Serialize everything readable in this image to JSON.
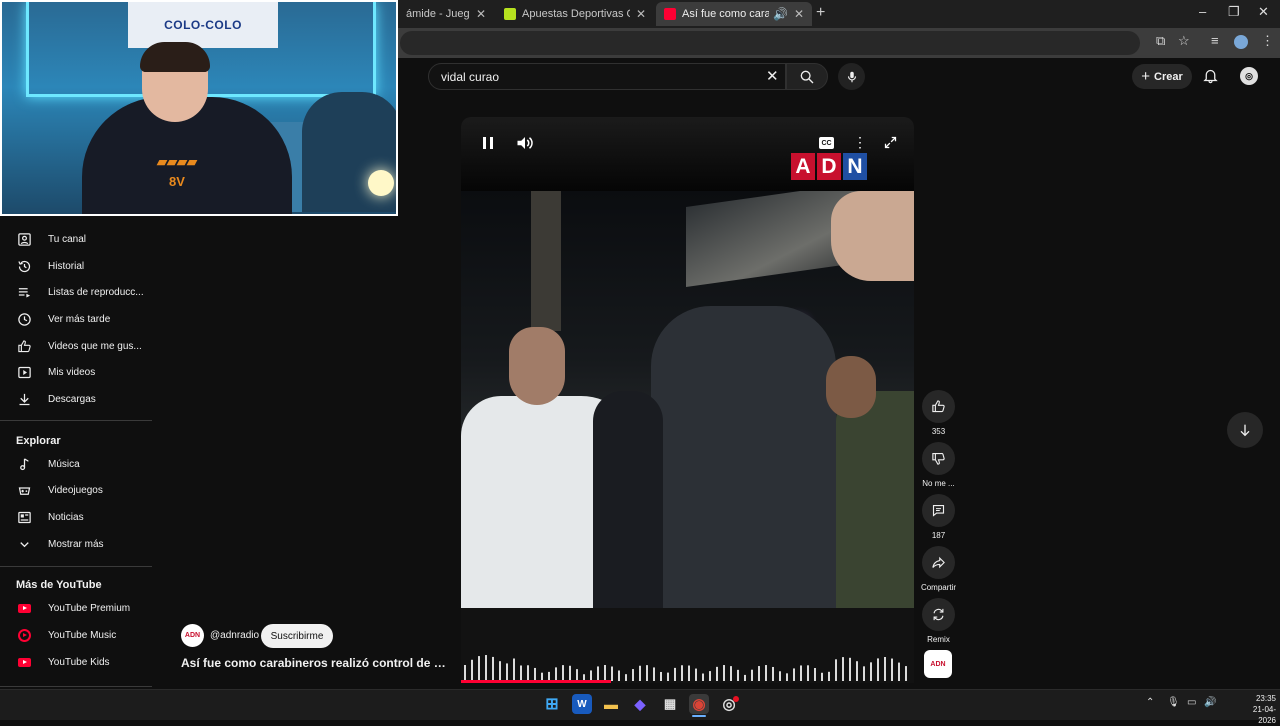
{
  "browser": {
    "tabs": [
      {
        "title": "ámide - Juega al ju",
        "active": false,
        "favicon_color": "#2a2a2a"
      },
      {
        "title": "Apuestas Deportivas Online en",
        "active": false,
        "favicon_color": "#b6e21f"
      },
      {
        "title": "Así fue como carabineros r",
        "active": true,
        "favicon_color": "#ff0033"
      }
    ],
    "new_tab": "+",
    "window_controls": {
      "minimize": "–",
      "restore": "❐",
      "close": "✕"
    }
  },
  "youtube": {
    "search": {
      "value": "vidal curao"
    },
    "create_label": "Crear"
  },
  "webcam": {
    "flag_text": "COLO-COLO",
    "hoodie_text": "8V"
  },
  "sidebar": {
    "you_items": [
      {
        "label": "Tu canal",
        "icon": "channel-icon"
      },
      {
        "label": "Historial",
        "icon": "history-icon"
      },
      {
        "label": "Listas de reproducc...",
        "icon": "playlist-icon"
      },
      {
        "label": "Ver más tarde",
        "icon": "watch-later-icon"
      },
      {
        "label": "Videos que me gus...",
        "icon": "like-icon"
      },
      {
        "label": "Mis videos",
        "icon": "my-videos-icon"
      },
      {
        "label": "Descargas",
        "icon": "download-icon"
      }
    ],
    "explore_heading": "Explorar",
    "explore_items": [
      {
        "label": "Música",
        "icon": "music-icon"
      },
      {
        "label": "Videojuegos",
        "icon": "gaming-icon"
      },
      {
        "label": "Noticias",
        "icon": "news-icon"
      },
      {
        "label": "Mostrar más",
        "icon": "chevron-down-icon"
      }
    ],
    "more_heading": "Más de YouTube",
    "more_items": [
      {
        "label": "YouTube Premium",
        "icon": "youtube-premium-icon"
      },
      {
        "label": "YouTube Music",
        "icon": "youtube-music-icon"
      },
      {
        "label": "YouTube Kids",
        "icon": "youtube-kids-icon"
      }
    ]
  },
  "short": {
    "logo_letters": [
      "A",
      "D",
      "N"
    ],
    "logo_colors": [
      "#c8102e",
      "#c8102e",
      "#1f4fa3"
    ],
    "cc_label": "CC",
    "channel_handle": "@adnradio",
    "channel_avatar_text": "ADN",
    "subscribe_label": "Suscribirme",
    "title": "Así fue como carabineros realizó control de identidad a Vidal en Santiago",
    "actions": {
      "like_count": "353",
      "dislike_label": "No me ...",
      "comment_count": "187",
      "share_label": "Compartir",
      "remix_label": "Remix"
    },
    "sound_thumb_text": "ADN"
  },
  "taskbar": {
    "apps": [
      {
        "name": "start-button",
        "glyph": "⊞",
        "color": "#3fa9f5"
      },
      {
        "name": "word-app",
        "glyph": "W",
        "color": "#185abd"
      },
      {
        "name": "file-explorer-app",
        "glyph": "▬",
        "color": "#f2c14e"
      },
      {
        "name": "copilot-app",
        "glyph": "◆",
        "color": "#7b61ff"
      },
      {
        "name": "store-app",
        "glyph": "▦",
        "color": "#555555"
      },
      {
        "name": "chrome-app",
        "glyph": "◉",
        "color": "#db4437"
      },
      {
        "name": "obs-app",
        "glyph": "◎",
        "color": "#3a3a3a"
      }
    ],
    "time": "23:35",
    "date": "21-04-2026"
  }
}
